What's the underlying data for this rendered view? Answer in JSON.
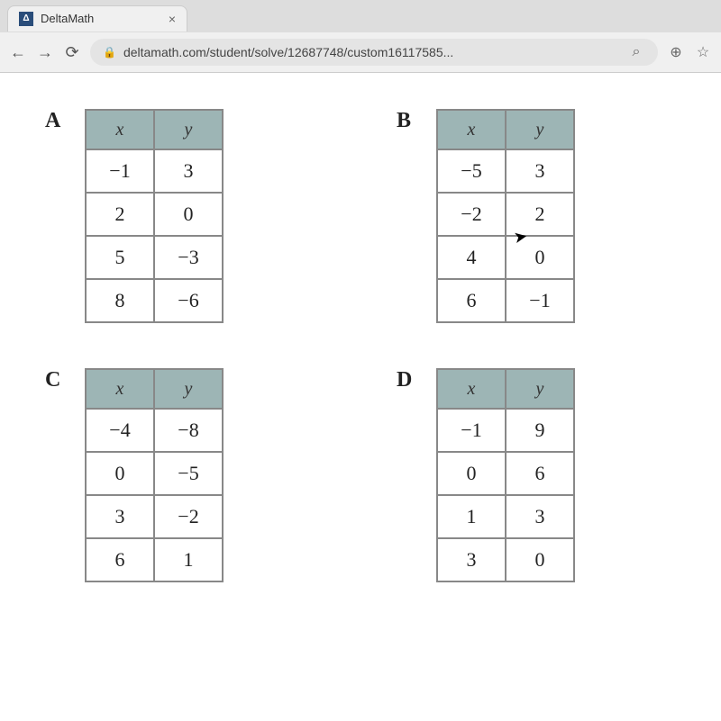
{
  "browser": {
    "tab_title": "DeltaMath",
    "tab_close": "×",
    "nav_back": "←",
    "nav_forward": "→",
    "nav_reload": "⟳",
    "lock": "🔒",
    "url": "deltamath.com/student/solve/12687748/custom16117585...",
    "key_icon": "⌕",
    "zoom_icon": "⊕",
    "star_icon": "☆"
  },
  "tables": [
    {
      "label": "A",
      "headers": {
        "x": "x",
        "y": "y"
      },
      "rows": [
        {
          "x": "−1",
          "y": "3"
        },
        {
          "x": "2",
          "y": "0"
        },
        {
          "x": "5",
          "y": "−3"
        },
        {
          "x": "8",
          "y": "−6"
        }
      ]
    },
    {
      "label": "B",
      "headers": {
        "x": "x",
        "y": "y"
      },
      "rows": [
        {
          "x": "−5",
          "y": "3"
        },
        {
          "x": "−2",
          "y": "2"
        },
        {
          "x": "4",
          "y": "0"
        },
        {
          "x": "6",
          "y": "−1"
        }
      ]
    },
    {
      "label": "C",
      "headers": {
        "x": "x",
        "y": "y"
      },
      "rows": [
        {
          "x": "−4",
          "y": "−8"
        },
        {
          "x": "0",
          "y": "−5"
        },
        {
          "x": "3",
          "y": "−2"
        },
        {
          "x": "6",
          "y": "1"
        }
      ]
    },
    {
      "label": "D",
      "headers": {
        "x": "x",
        "y": "y"
      },
      "rows": [
        {
          "x": "−1",
          "y": "9"
        },
        {
          "x": "0",
          "y": "6"
        },
        {
          "x": "1",
          "y": "3"
        },
        {
          "x": "3",
          "y": "0"
        }
      ]
    }
  ]
}
